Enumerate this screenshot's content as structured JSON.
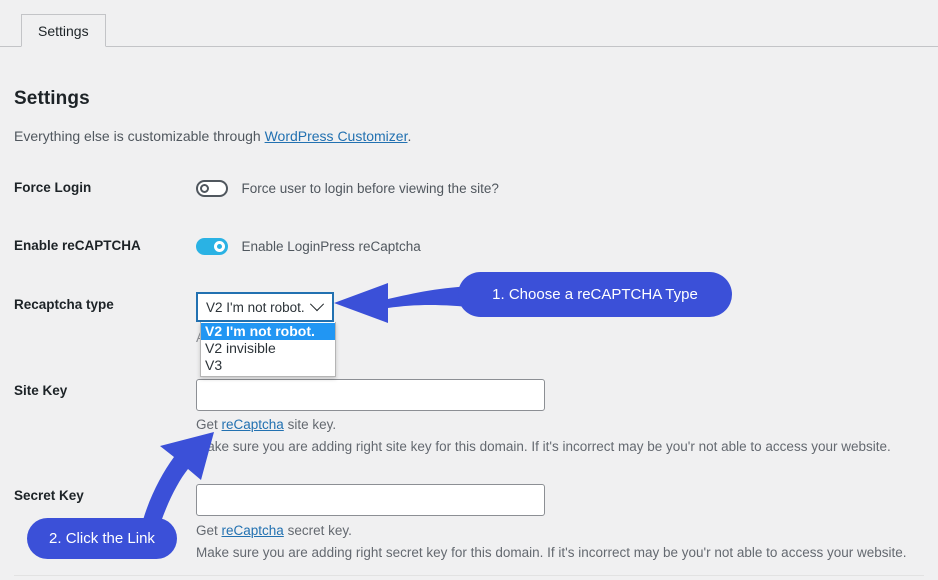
{
  "tab": {
    "label": "Settings"
  },
  "header": {
    "title": "Settings",
    "subtitle_before": "Everything else is customizable through ",
    "subtitle_link": "WordPress Customizer",
    "subtitle_after": "."
  },
  "rows": {
    "force_login": {
      "label": "Force Login",
      "toggle_state": "off",
      "description": "Force user to login before viewing the site?"
    },
    "enable_recaptcha": {
      "label": "Enable reCAPTCHA",
      "toggle_state": "on",
      "description": "Enable LoginPress reCaptcha"
    },
    "recaptcha_type": {
      "label": "Recaptcha type",
      "selected": "V2 I'm not robot.",
      "options": [
        "V2 I'm not robot.",
        "V2 invisible",
        "V3"
      ],
      "chevron_icon": "chevron-down-icon",
      "obscured_help": "APTCHA"
    },
    "site_key": {
      "label": "Site Key",
      "value": "",
      "help_before": "Get ",
      "help_link": "reCaptcha",
      "help_after": " site key.",
      "note": "Make sure you are adding right site key for this domain. If it's incorrect may be you'r not able to access your website."
    },
    "secret_key": {
      "label": "Secret Key",
      "value": "",
      "help_before": "Get ",
      "help_link": "reCaptcha",
      "help_after": " secret key.",
      "note": "Make sure you are adding right secret key for this domain. If it's incorrect may be you'r not able to access your website."
    }
  },
  "callouts": [
    {
      "id": "callout-1",
      "label": "1. Choose a reCAPTCHA Type",
      "arrow": "arrow-left"
    },
    {
      "id": "callout-2",
      "label": "2. Click the Link",
      "arrow": "arrow-up-right"
    }
  ],
  "colors": {
    "callout_blue": "#3b50d8",
    "toggle_on": "#2ab2e4",
    "link_blue": "#2271b1",
    "option_highlight": "#2196f3",
    "page_bg": "#f0f0f1"
  }
}
